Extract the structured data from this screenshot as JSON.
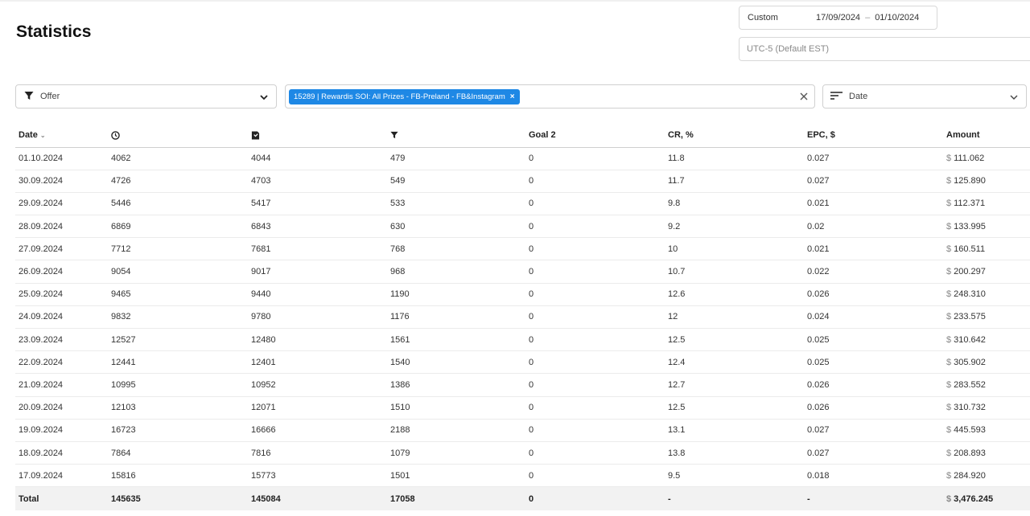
{
  "page": {
    "title": "Statistics"
  },
  "date_range": {
    "preset": "Custom",
    "from": "17/09/2024",
    "separator": "–",
    "to": "01/10/2024"
  },
  "timezone": {
    "placeholder": "UTC-5 (Default EST)"
  },
  "filters": {
    "offer_label": "Offer",
    "selected_offer_chip": "15289 | Rewardis SOI: All Prizes - FB-Preland - FB&Instagram",
    "chip_remove": "×",
    "group_by_label": "Date"
  },
  "table": {
    "columns": {
      "date": "Date",
      "clicks_icon": "clock-icon",
      "unique_icon": "bookmark-icon",
      "conversions_icon": "funnel-icon",
      "goal2": "Goal 2",
      "cr": "CR, %",
      "epc": "EPC, $",
      "amount": "Amount"
    },
    "currency": "$",
    "rows": [
      {
        "date": "01.10.2024",
        "clicks": "4062",
        "unique": "4044",
        "conv": "479",
        "goal2": "0",
        "cr": "11.8",
        "epc": "0.027",
        "amount": "111.062"
      },
      {
        "date": "30.09.2024",
        "clicks": "4726",
        "unique": "4703",
        "conv": "549",
        "goal2": "0",
        "cr": "11.7",
        "epc": "0.027",
        "amount": "125.890"
      },
      {
        "date": "29.09.2024",
        "clicks": "5446",
        "unique": "5417",
        "conv": "533",
        "goal2": "0",
        "cr": "9.8",
        "epc": "0.021",
        "amount": "112.371"
      },
      {
        "date": "28.09.2024",
        "clicks": "6869",
        "unique": "6843",
        "conv": "630",
        "goal2": "0",
        "cr": "9.2",
        "epc": "0.02",
        "amount": "133.995"
      },
      {
        "date": "27.09.2024",
        "clicks": "7712",
        "unique": "7681",
        "conv": "768",
        "goal2": "0",
        "cr": "10",
        "epc": "0.021",
        "amount": "160.511"
      },
      {
        "date": "26.09.2024",
        "clicks": "9054",
        "unique": "9017",
        "conv": "968",
        "goal2": "0",
        "cr": "10.7",
        "epc": "0.022",
        "amount": "200.297"
      },
      {
        "date": "25.09.2024",
        "clicks": "9465",
        "unique": "9440",
        "conv": "1190",
        "goal2": "0",
        "cr": "12.6",
        "epc": "0.026",
        "amount": "248.310"
      },
      {
        "date": "24.09.2024",
        "clicks": "9832",
        "unique": "9780",
        "conv": "1176",
        "goal2": "0",
        "cr": "12",
        "epc": "0.024",
        "amount": "233.575"
      },
      {
        "date": "23.09.2024",
        "clicks": "12527",
        "unique": "12480",
        "conv": "1561",
        "goal2": "0",
        "cr": "12.5",
        "epc": "0.025",
        "amount": "310.642"
      },
      {
        "date": "22.09.2024",
        "clicks": "12441",
        "unique": "12401",
        "conv": "1540",
        "goal2": "0",
        "cr": "12.4",
        "epc": "0.025",
        "amount": "305.902"
      },
      {
        "date": "21.09.2024",
        "clicks": "10995",
        "unique": "10952",
        "conv": "1386",
        "goal2": "0",
        "cr": "12.7",
        "epc": "0.026",
        "amount": "283.552"
      },
      {
        "date": "20.09.2024",
        "clicks": "12103",
        "unique": "12071",
        "conv": "1510",
        "goal2": "0",
        "cr": "12.5",
        "epc": "0.026",
        "amount": "310.732"
      },
      {
        "date": "19.09.2024",
        "clicks": "16723",
        "unique": "16666",
        "conv": "2188",
        "goal2": "0",
        "cr": "13.1",
        "epc": "0.027",
        "amount": "445.593"
      },
      {
        "date": "18.09.2024",
        "clicks": "7864",
        "unique": "7816",
        "conv": "1079",
        "goal2": "0",
        "cr": "13.8",
        "epc": "0.027",
        "amount": "208.893"
      },
      {
        "date": "17.09.2024",
        "clicks": "15816",
        "unique": "15773",
        "conv": "1501",
        "goal2": "0",
        "cr": "9.5",
        "epc": "0.018",
        "amount": "284.920"
      }
    ],
    "total": {
      "label": "Total",
      "clicks": "145635",
      "unique": "145084",
      "conv": "17058",
      "goal2": "0",
      "cr": "-",
      "epc": "-",
      "amount": "3,476.245"
    }
  }
}
